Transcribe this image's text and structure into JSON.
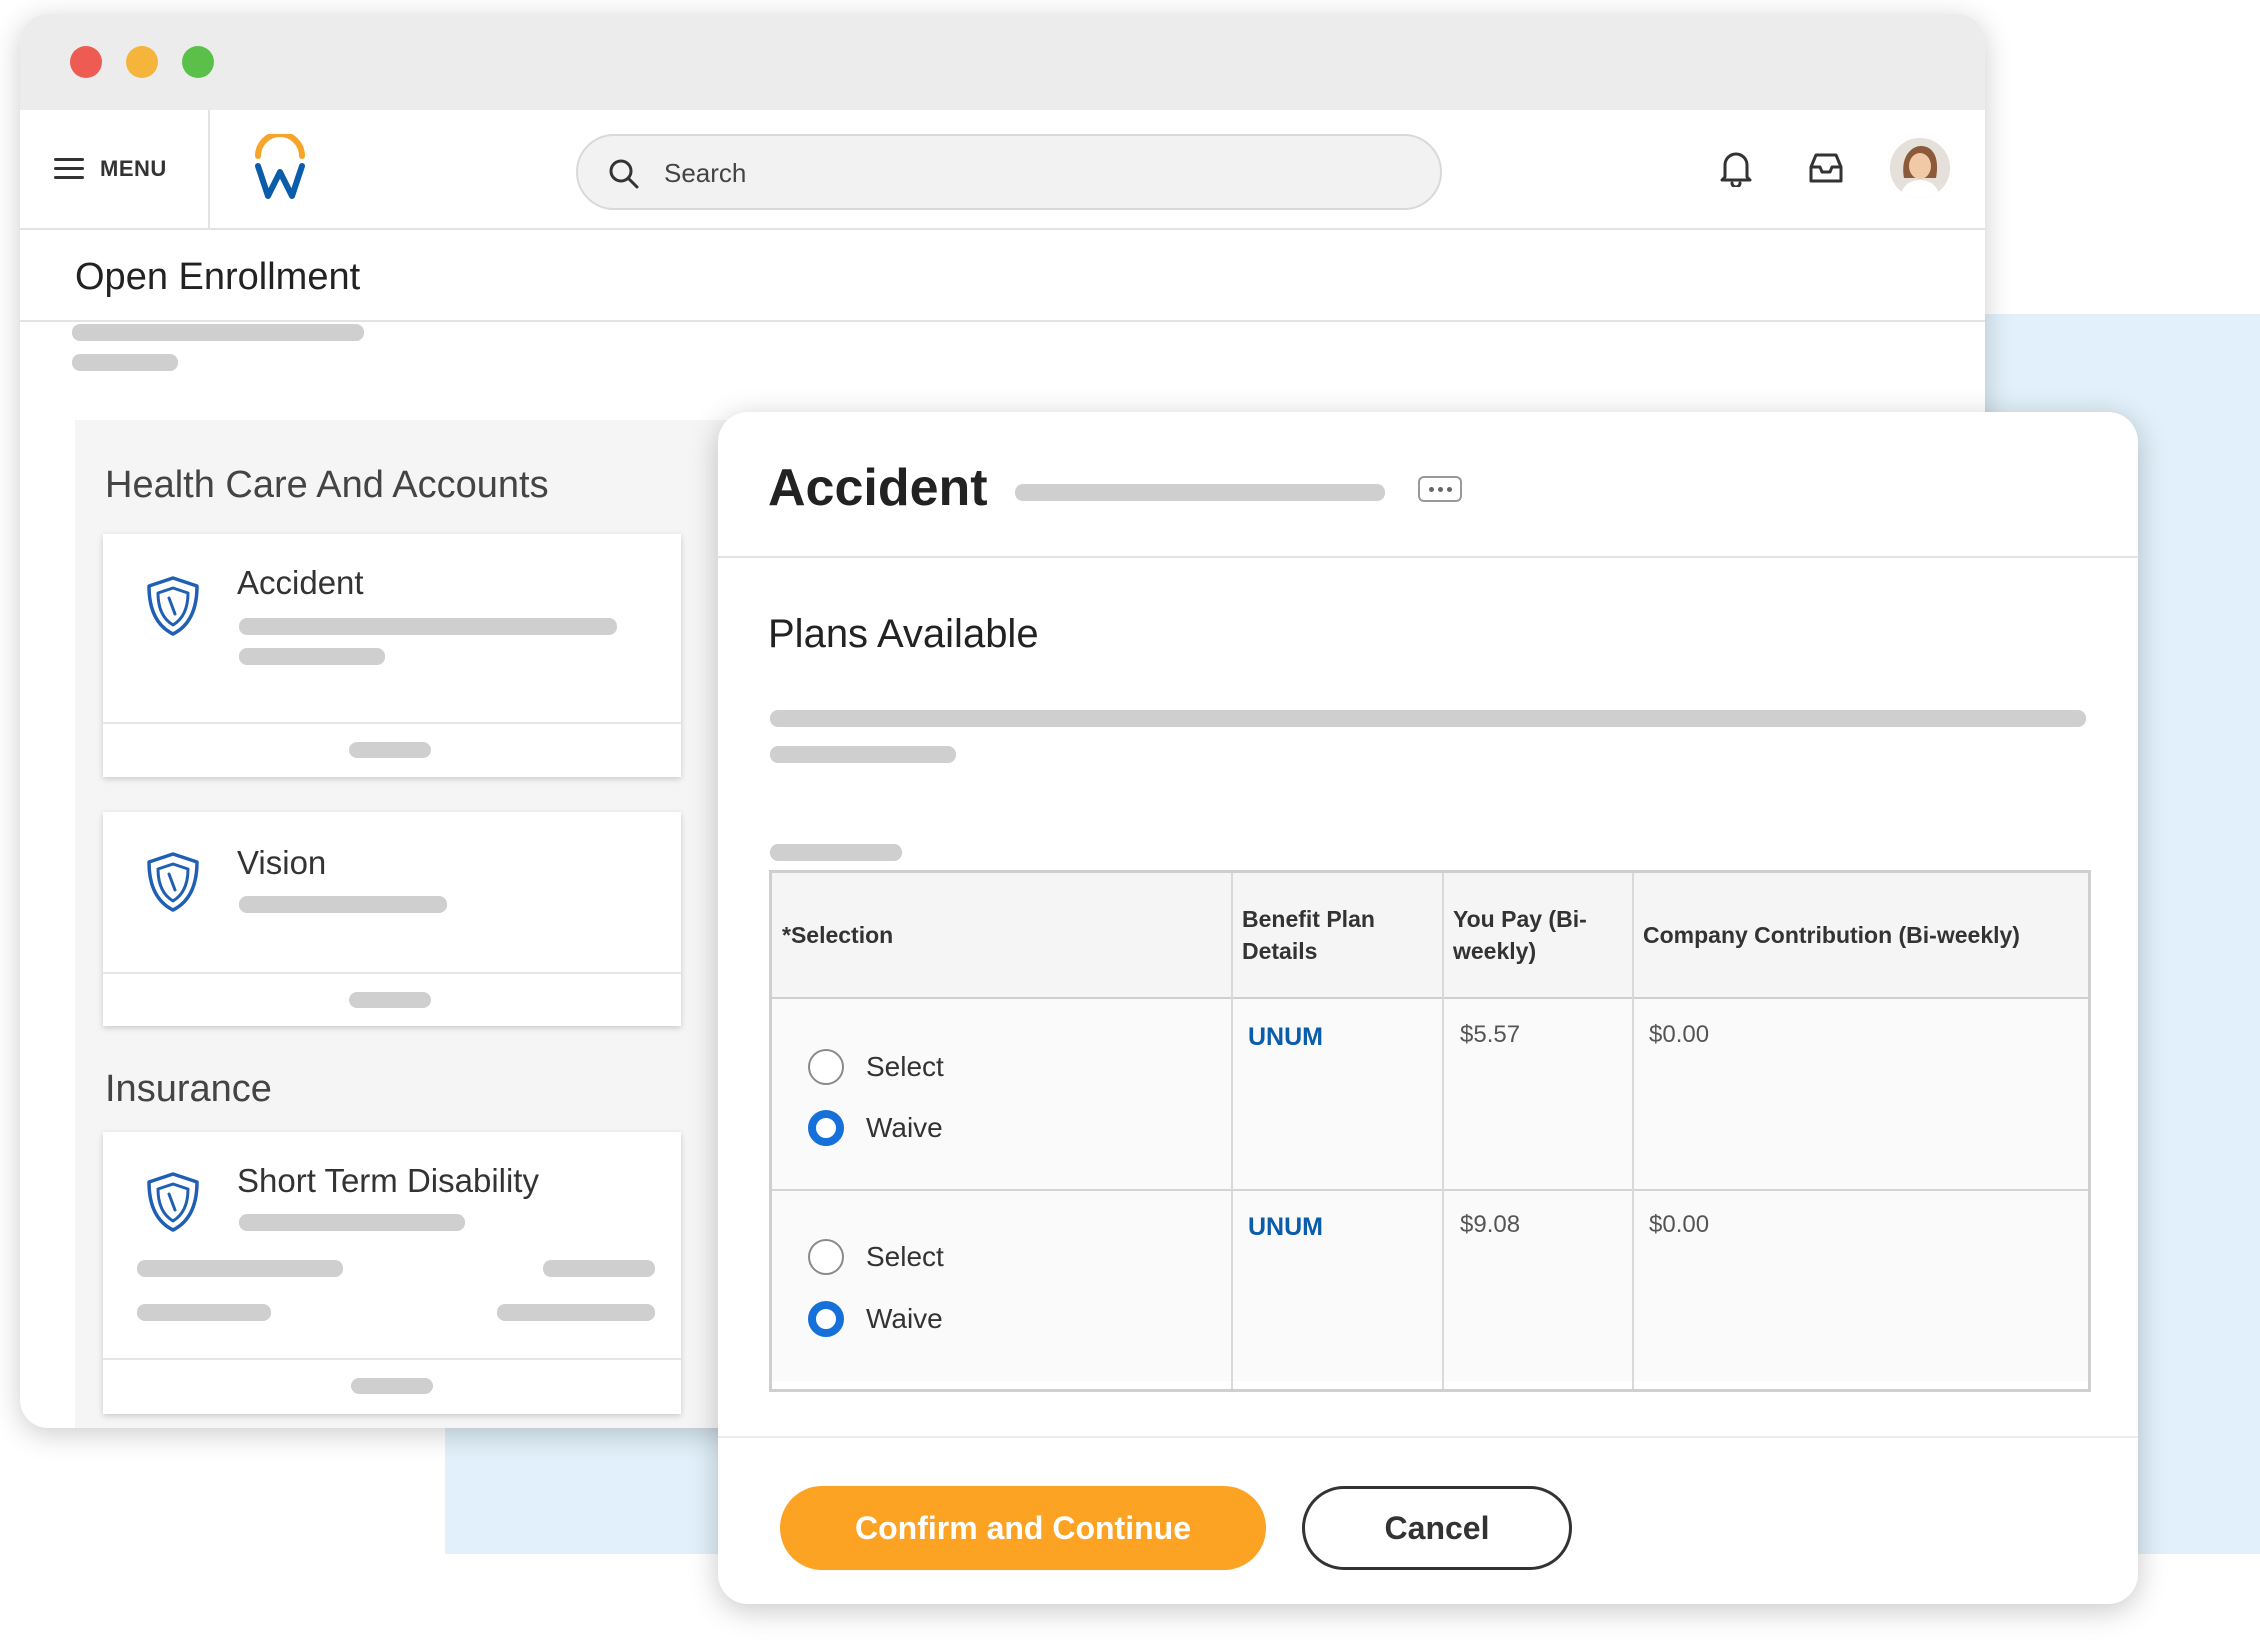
{
  "nav": {
    "menu_label": "MENU",
    "search_placeholder": "Search"
  },
  "page": {
    "title": "Open Enrollment"
  },
  "sections": [
    {
      "title": "Health Care And Accounts",
      "cards": [
        {
          "title": "Accident"
        },
        {
          "title": "Vision"
        }
      ]
    },
    {
      "title": "Insurance",
      "cards": [
        {
          "title": "Short Term Disability"
        }
      ]
    }
  ],
  "modal": {
    "title": "Accident",
    "plans_title": "Plans Available",
    "table": {
      "headers": [
        "*Selection",
        "Benefit Plan Details",
        "You Pay (Bi-weekly)",
        "Company Contribution (Bi-weekly)"
      ],
      "rows": [
        {
          "options": [
            "Select",
            "Waive"
          ],
          "selected": "Waive",
          "plan": "UNUM",
          "you_pay": "$5.57",
          "company": "$0.00"
        },
        {
          "options": [
            "Select",
            "Waive"
          ],
          "selected": "Waive",
          "plan": "UNUM",
          "you_pay": "$9.08",
          "company": "$0.00"
        }
      ]
    },
    "confirm_label": "Confirm and Continue",
    "cancel_label": "Cancel"
  },
  "colors": {
    "accent_orange": "#fca324",
    "link_blue": "#0b5cab",
    "radio_blue": "#1570d9",
    "background_blue": "#e1f0fa",
    "shield_blue": "#1f5fb4"
  }
}
